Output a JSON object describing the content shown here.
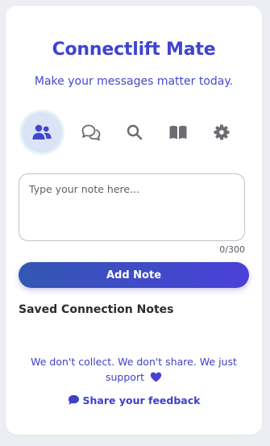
{
  "app": {
    "title": "Connectlift Mate",
    "tagline": "Make your messages matter today."
  },
  "nav": {
    "active": "connections",
    "tabs": [
      {
        "id": "connections",
        "icon": "users-icon"
      },
      {
        "id": "messages",
        "icon": "chat-bubbles-icon"
      },
      {
        "id": "search",
        "icon": "search-icon"
      },
      {
        "id": "guide",
        "icon": "book-icon"
      },
      {
        "id": "settings",
        "icon": "gear-icon"
      }
    ]
  },
  "note": {
    "placeholder": "Type your note here...",
    "value": "",
    "counter": "0/300"
  },
  "actions": {
    "add_note_label": "Add Note"
  },
  "saved": {
    "heading": "Saved Connection Notes",
    "items": []
  },
  "footer": {
    "privacy_text": "We don't collect. We don't share. We just support",
    "feedback_label": "Share your feedback"
  },
  "colors": {
    "accent": "#3f44d0",
    "button_gradient_start": "#3357b3",
    "button_gradient_end": "#4a40d8",
    "active_tab_bg": "#dbe4f6",
    "icon_gray": "#6b6d73",
    "heart": "#4a3fd6"
  }
}
